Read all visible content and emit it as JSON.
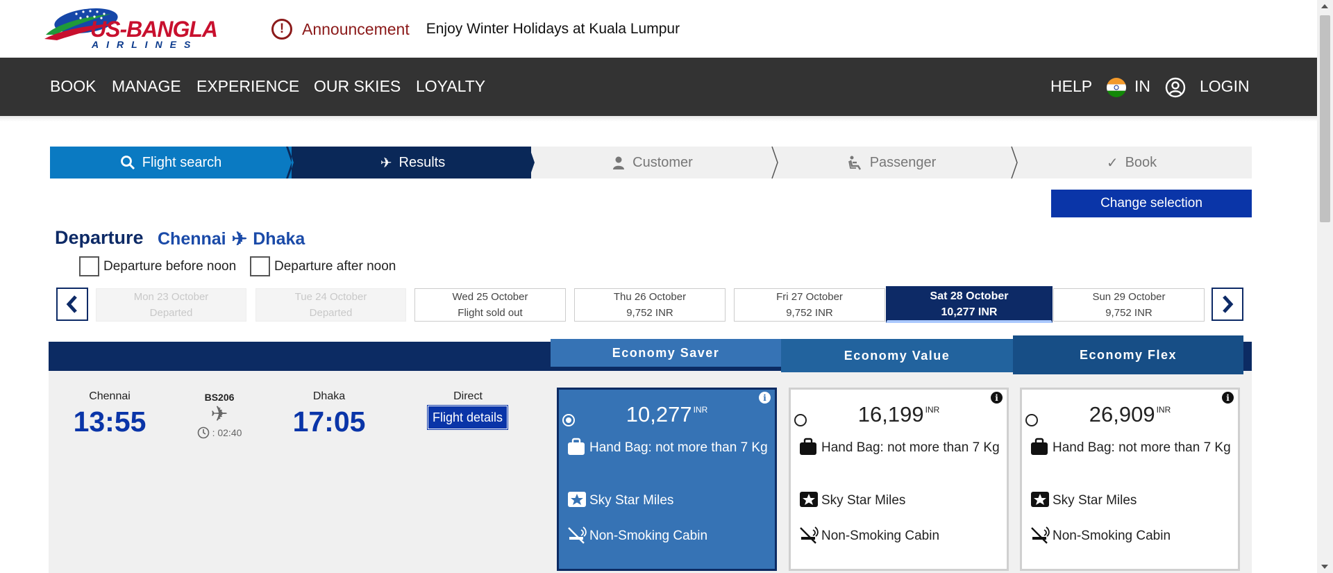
{
  "announcement": {
    "label": "Announcement",
    "message": "Enjoy Winter Holidays at Kuala Lumpur"
  },
  "logo": {
    "line1": "US-BANGLA",
    "line2": "AIRLINES"
  },
  "nav": {
    "items": [
      "BOOK",
      "MANAGE",
      "EXPERIENCE",
      "OUR SKIES",
      "LOYALTY"
    ],
    "help": "HELP",
    "country": "IN",
    "login": "LOGIN"
  },
  "steps": [
    {
      "label": "Flight search",
      "icon": "search-icon",
      "state": "done"
    },
    {
      "label": "Results",
      "icon": "plane-icon",
      "state": "current"
    },
    {
      "label": "Customer",
      "icon": "person-icon",
      "state": "pending"
    },
    {
      "label": "Passenger",
      "icon": "seat-icon",
      "state": "pending"
    },
    {
      "label": "Book",
      "icon": "check-icon",
      "state": "pending"
    }
  ],
  "change_selection": "Change selection",
  "departure": {
    "title": "Departure",
    "from": "Chennai",
    "to": "Dhaka"
  },
  "filters": {
    "before_noon": "Departure before noon",
    "after_noon": "Departure after noon"
  },
  "dates": [
    {
      "day": "Mon 23 October",
      "info": "Departed",
      "state": "disabled"
    },
    {
      "day": "Tue 24 October",
      "info": "Departed",
      "state": "disabled"
    },
    {
      "day": "Wed 25 October",
      "info": "Flight sold out",
      "state": "normal"
    },
    {
      "day": "Thu 26 October",
      "info": "9,752 INR",
      "state": "normal"
    },
    {
      "day": "Fri 27 October",
      "info": "9,752 INR",
      "state": "normal"
    },
    {
      "day": "Sat 28 October",
      "info": "10,277 INR",
      "state": "selected"
    },
    {
      "day": "Sun 29 October",
      "info": "9,752 INR",
      "state": "normal"
    }
  ],
  "fare_families": [
    "Economy Saver",
    "Economy Value",
    "Economy Flex"
  ],
  "flight": {
    "origin_city": "Chennai",
    "departure_time": "13:55",
    "flight_number": "BS206",
    "duration": ": 02:40",
    "destination_city": "Dhaka",
    "arrival_time": "17:05",
    "stops": "Direct",
    "details_label": "Flight details"
  },
  "fares": [
    {
      "price": "10,277",
      "currency": "INR",
      "selected": true,
      "features": [
        "Hand Bag: not more than 7 Kg",
        "Sky Star Miles",
        "Non-Smoking Cabin"
      ]
    },
    {
      "price": "16,199",
      "currency": "INR",
      "selected": false,
      "features": [
        "Hand Bag: not more than 7 Kg",
        "Sky Star Miles",
        "Non-Smoking Cabin"
      ]
    },
    {
      "price": "26,909",
      "currency": "INR",
      "selected": false,
      "features": [
        "Hand Bag: not more than 7 Kg",
        "Sky Star Miles",
        "Non-Smoking Cabin"
      ]
    }
  ],
  "colors": {
    "nav_bg": "#333333",
    "primary_blue": "#0a35a8",
    "dark_navy": "#0c2b63",
    "step_done": "#0a7ac2",
    "selected_card": "#3673b5",
    "announcement_red": "#8b1a1a"
  }
}
